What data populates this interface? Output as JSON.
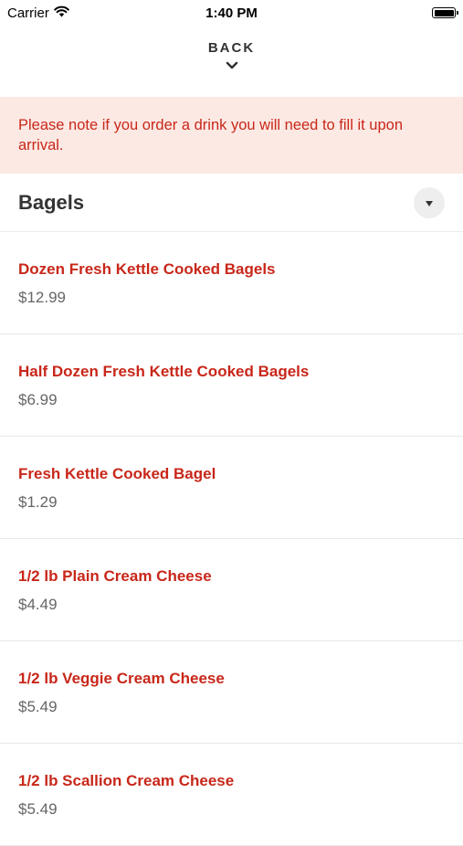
{
  "status_bar": {
    "carrier": "Carrier",
    "time": "1:40 PM"
  },
  "nav": {
    "back_label": "BACK"
  },
  "notice": {
    "text": "Please note if you order a drink you will need to fill it upon arrival."
  },
  "section": {
    "title": "Bagels"
  },
  "items": [
    {
      "name": "Dozen Fresh Kettle Cooked Bagels",
      "price": "$12.99"
    },
    {
      "name": "Half Dozen Fresh Kettle Cooked Bagels",
      "price": "$6.99"
    },
    {
      "name": "Fresh Kettle Cooked Bagel",
      "price": "$1.29"
    },
    {
      "name": "1/2 lb Plain Cream Cheese",
      "price": "$4.49"
    },
    {
      "name": "1/2 lb Veggie Cream Cheese",
      "price": "$5.49"
    },
    {
      "name": "1/2 lb Scallion Cream Cheese",
      "price": "$5.49"
    }
  ],
  "colors": {
    "accent": "#c8271a",
    "notice_bg": "#fde9e4"
  }
}
